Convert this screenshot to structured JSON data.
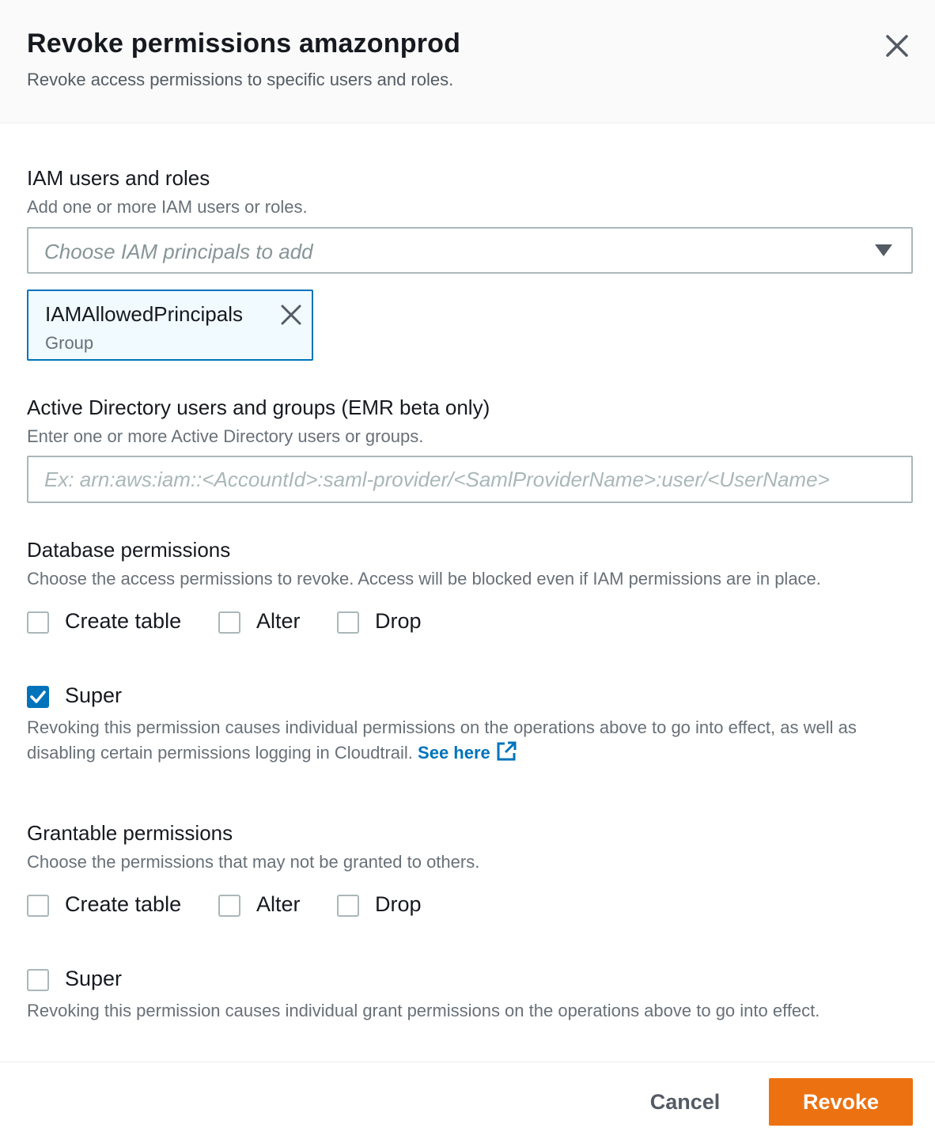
{
  "dialog": {
    "title": "Revoke permissions amazonprod",
    "subtitle": "Revoke access permissions to specific users and roles.",
    "close_icon": "close-icon"
  },
  "iam": {
    "label": "IAM users and roles",
    "description": "Add one or more IAM users or roles.",
    "select_placeholder": "Choose IAM principals to add",
    "tokens": [
      {
        "name": "IAMAllowedPrincipals",
        "type": "Group"
      }
    ]
  },
  "active_directory": {
    "label": "Active Directory users and groups (EMR beta only)",
    "description": "Enter one or more Active Directory users or groups.",
    "placeholder": "Ex: arn:aws:iam::<AccountId>:saml-provider/<SamlProviderName>:user/<UserName>",
    "value": ""
  },
  "database_permissions": {
    "label": "Database permissions",
    "description": "Choose the access permissions to revoke. Access will be blocked even if IAM permissions are in place.",
    "options": [
      {
        "label": "Create table",
        "checked": false
      },
      {
        "label": "Alter",
        "checked": false
      },
      {
        "label": "Drop",
        "checked": false
      }
    ],
    "super": {
      "label": "Super",
      "checked": true,
      "help": "Revoking this permission causes individual permissions on the operations above to go into effect, as well as disabling certain permissions logging in Cloudtrail.",
      "link_text": "See here"
    }
  },
  "grantable_permissions": {
    "label": "Grantable permissions",
    "description": "Choose the permissions that may not be granted to others.",
    "options": [
      {
        "label": "Create table",
        "checked": false
      },
      {
        "label": "Alter",
        "checked": false
      },
      {
        "label": "Drop",
        "checked": false
      }
    ],
    "super": {
      "label": "Super",
      "checked": false,
      "help": "Revoking this permission causes individual grant permissions on the operations above to go into effect."
    }
  },
  "footer": {
    "cancel_label": "Cancel",
    "revoke_label": "Revoke"
  },
  "colors": {
    "accent": "#0073bb",
    "primary_button": "#ec7211"
  }
}
